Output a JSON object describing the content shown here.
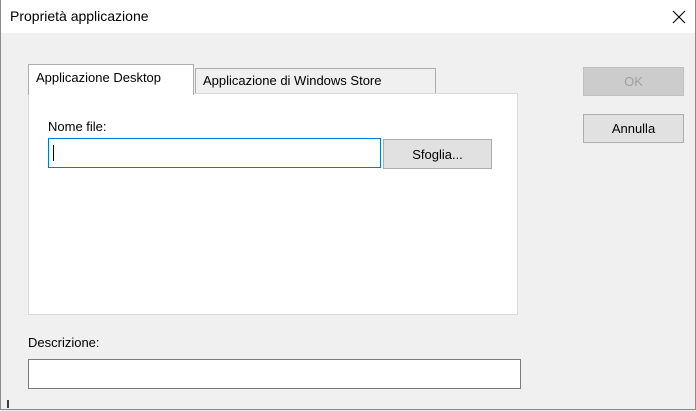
{
  "window": {
    "title": "Proprietà applicazione"
  },
  "tabs": [
    {
      "label": "Applicazione Desktop",
      "selected": true
    },
    {
      "label": "Applicazione di Windows Store",
      "selected": false
    }
  ],
  "desktop_tab": {
    "file_label": "Nome file:",
    "file_value": "",
    "browse_label": "Sfoglia..."
  },
  "description": {
    "label": "Descrizione:",
    "value": ""
  },
  "buttons": {
    "ok_label": "OK",
    "ok_enabled": false,
    "cancel_label": "Annulla"
  },
  "icons": {
    "close": "close-icon"
  }
}
